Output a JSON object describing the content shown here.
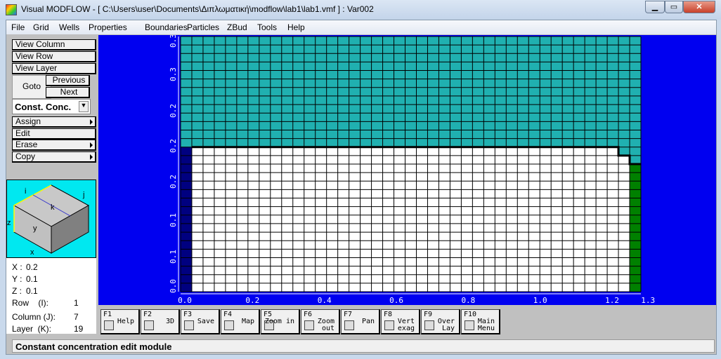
{
  "window": {
    "title": "Visual MODFLOW - [ C:\\Users\\user\\Documents\\Διπλωματική\\modflow\\lab1\\lab1.vmf ] : Var002"
  },
  "menu": [
    "File",
    "Grid",
    "Wells",
    "Properties",
    "Boundaries",
    "Particles",
    "ZBud",
    "Tools",
    "Help"
  ],
  "left": {
    "view_column": "View Column",
    "view_row": "View Row",
    "view_layer": "View Layer",
    "goto": "Goto",
    "previous": "Previous",
    "next": "Next",
    "boundary_select": "Const. Conc.",
    "assign": "Assign",
    "edit": "Edit",
    "erase": "Erase",
    "copy": "Copy"
  },
  "cube": {
    "i": "i",
    "j": "j",
    "k": "k",
    "x": "x",
    "y": "y",
    "z": "z"
  },
  "coords": {
    "x_label": "X :",
    "x": "0.2",
    "y_label": "Y :",
    "y": "0.1",
    "z_label": "Z :",
    "z": "0.1",
    "row_label": "Row    (I):",
    "row": "1",
    "col_label": "Column (J):",
    "col": "7",
    "layer_label": "Layer  (K):",
    "layer": "19"
  },
  "grid": {
    "x_ticks": [
      "0.0",
      "0.2",
      "0.4",
      "0.6",
      "0.8",
      "1.0",
      "1.2",
      "1.3"
    ],
    "y_ticks": [
      "0.3",
      "0.3",
      "0.2",
      "0.2",
      "0.2",
      "0.1",
      "0.1",
      "0.0"
    ],
    "colors": {
      "background": "#0000f0",
      "const_conc": "#20b0b0",
      "inactive": "#000080",
      "green_column": "#008000",
      "active": "#ffffff"
    }
  },
  "fkeys": [
    {
      "key": "F1",
      "label": "Help",
      "icon": "help-icon"
    },
    {
      "key": "F2",
      "label": "3D",
      "icon": "3d-icon"
    },
    {
      "key": "F3",
      "label": "Save",
      "icon": "save-icon"
    },
    {
      "key": "F4",
      "label": "Map",
      "icon": "globe-icon"
    },
    {
      "key": "F5",
      "label": "Zoom in",
      "icon": "zoom-in-icon"
    },
    {
      "key": "F6",
      "label": "Zoom out",
      "icon": "zoom-out-icon"
    },
    {
      "key": "F7",
      "label": "Pan",
      "icon": "pan-icon"
    },
    {
      "key": "F8",
      "label": "Vert exag",
      "icon": "vert-exag-icon"
    },
    {
      "key": "F9",
      "label": "Over Lay",
      "icon": "overlay-icon"
    },
    {
      "key": "F10",
      "label": "Main Menu",
      "icon": "main-menu-icon"
    }
  ],
  "status": "Constant concentration edit module"
}
